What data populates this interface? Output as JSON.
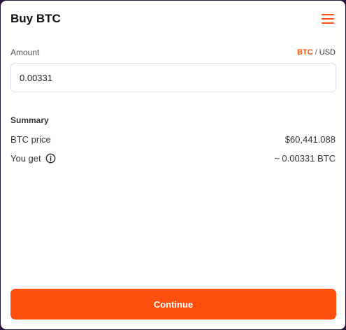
{
  "header": {
    "title": "Buy BTC",
    "menu_icon": "hamburger-menu-icon"
  },
  "amount": {
    "label": "Amount",
    "unit_active": "BTC",
    "unit_separator": "/",
    "unit_other": "USD",
    "value": "0.00331"
  },
  "summary": {
    "title": "Summary",
    "price_label": "BTC price",
    "price_value": "$60,441.088",
    "get_label": "You get",
    "get_icon": "info-icon",
    "get_value": "~ 0.00331 BTC"
  },
  "footer": {
    "continue_label": "Continue"
  },
  "colors": {
    "accent": "#ff4f0f",
    "background": "#2a1740",
    "card": "#ffffff"
  }
}
